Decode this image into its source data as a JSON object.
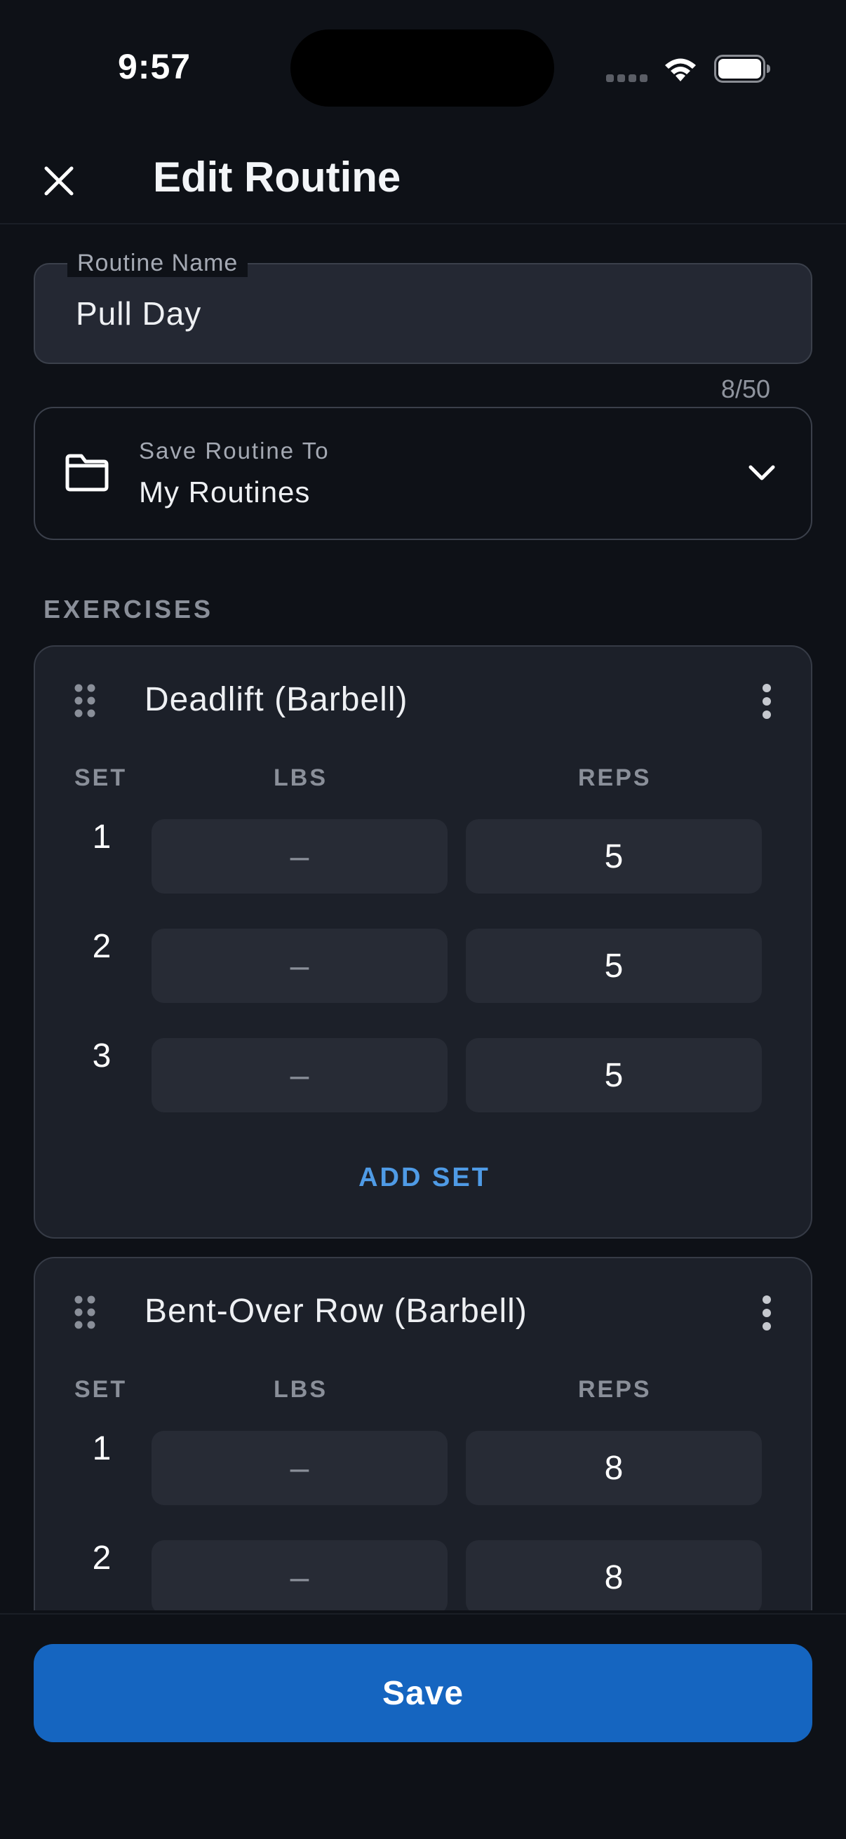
{
  "status_bar": {
    "time": "9:57"
  },
  "header": {
    "title": "Edit Routine"
  },
  "routine_name": {
    "label": "Routine Name",
    "value": "Pull Day",
    "counter": "8/50"
  },
  "save_to": {
    "label": "Save Routine To",
    "value": "My Routines"
  },
  "exercises_heading": "EXERCISES",
  "columns": {
    "set": "SET",
    "lbs": "LBS",
    "reps": "REPS"
  },
  "exercises": [
    {
      "name": "Deadlift (Barbell)",
      "sets": [
        {
          "set": "1",
          "lbs": "–",
          "reps": "5"
        },
        {
          "set": "2",
          "lbs": "–",
          "reps": "5"
        },
        {
          "set": "3",
          "lbs": "–",
          "reps": "5"
        }
      ],
      "add_set": "ADD SET"
    },
    {
      "name": "Bent-Over Row (Barbell)",
      "sets": [
        {
          "set": "1",
          "lbs": "–",
          "reps": "8"
        },
        {
          "set": "2",
          "lbs": "–",
          "reps": "8"
        }
      ]
    }
  ],
  "save_button": "Save",
  "colors": {
    "accent": "#1565c0",
    "link": "#4f9be6",
    "background": "#0e1117",
    "card": "#1c2029"
  },
  "icons": [
    "close-icon",
    "folder-icon",
    "chevron-down-icon",
    "drag-handle-icon",
    "more-vert-icon",
    "wifi-icon",
    "battery-icon"
  ]
}
